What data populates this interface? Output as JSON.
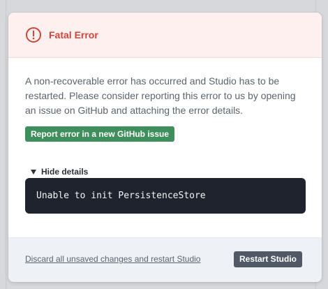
{
  "dialog": {
    "title": "Fatal Error",
    "title_icon": "error-circle-icon",
    "message": "A non-recoverable error has occurred and Studio has to be restarted. Please consider reporting this error to us by opening an issue on GitHub and attaching the error details.",
    "report_button_label": "Report error in a new GitHub issue",
    "details_toggle_label": "Hide details",
    "details_toggle_icon": "triangle-down-icon",
    "error_details": "Unable to init PersistenceStore",
    "discard_link_label": "Discard all unsaved changes and restart Studio",
    "restart_button_label": "Restart Studio"
  },
  "colors": {
    "error_red": "#d0453a",
    "header_bg": "#fdf0ee",
    "report_green": "#3f8f5c",
    "code_bg": "#1f232d",
    "footer_bg": "#eef1f6",
    "restart_button_bg": "#515866"
  }
}
